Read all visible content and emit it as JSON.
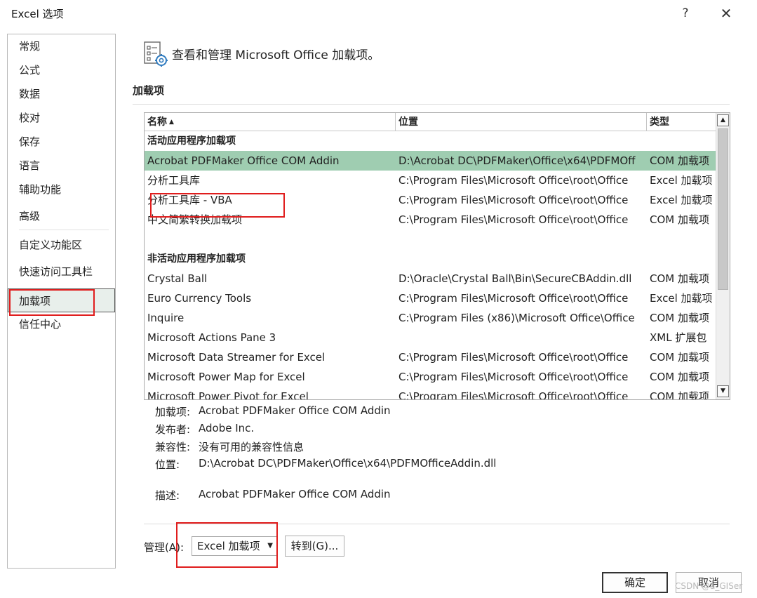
{
  "window": {
    "title": "Excel 选项",
    "help_label": "?",
    "close_label": "✕"
  },
  "sidebar": {
    "items": [
      {
        "label": "常规"
      },
      {
        "label": "公式"
      },
      {
        "label": "数据"
      },
      {
        "label": "校对"
      },
      {
        "label": "保存"
      },
      {
        "label": "语言"
      },
      {
        "label": "辅助功能"
      },
      {
        "label": "高级"
      },
      {
        "label": "自定义功能区"
      },
      {
        "label": "快速访问工具栏"
      },
      {
        "label": "加载项",
        "selected": true
      },
      {
        "label": "信任中心"
      }
    ]
  },
  "main": {
    "heading": "查看和管理 Microsoft Office 加载项。",
    "section_title": "加载项",
    "table": {
      "columns": [
        "名称",
        "位置",
        "类型"
      ],
      "sort_indicator": "▲",
      "active_group": "活动应用程序加载项",
      "active_rows": [
        {
          "name": "Acrobat PDFMaker Office COM Addin",
          "location": "D:\\Acrobat DC\\PDFMaker\\Office\\x64\\PDFMOff",
          "type": "COM 加载项",
          "selected": true
        },
        {
          "name": "分析工具库",
          "location": "C:\\Program Files\\Microsoft Office\\root\\Office",
          "type": "Excel 加载项"
        },
        {
          "name": "分析工具库 - VBA",
          "location": "C:\\Program Files\\Microsoft Office\\root\\Office",
          "type": "Excel 加载项"
        },
        {
          "name": "中文简繁转换加载项",
          "location": "C:\\Program Files\\Microsoft Office\\root\\Office",
          "type": "COM 加载项"
        }
      ],
      "inactive_group": "非活动应用程序加载项",
      "inactive_rows": [
        {
          "name": "Crystal Ball",
          "location": "D:\\Oracle\\Crystal Ball\\Bin\\SecureCBAddin.dll",
          "type": "COM 加载项"
        },
        {
          "name": "Euro Currency Tools",
          "location": "C:\\Program Files\\Microsoft Office\\root\\Office",
          "type": "Excel 加载项"
        },
        {
          "name": "Inquire",
          "location": "C:\\Program Files (x86)\\Microsoft Office\\Office",
          "type": "COM 加载项"
        },
        {
          "name": "Microsoft Actions Pane 3",
          "location": "",
          "type": "XML 扩展包"
        },
        {
          "name": "Microsoft Data Streamer for Excel",
          "location": "C:\\Program Files\\Microsoft Office\\root\\Office",
          "type": "COM 加载项"
        },
        {
          "name": "Microsoft Power Map for Excel",
          "location": "C:\\Program Files\\Microsoft Office\\root\\Office",
          "type": "COM 加载项"
        },
        {
          "name": "Microsoft Power Pivot for Excel",
          "location": "C:\\Program Files\\Microsoft Office\\root\\Office",
          "type": "COM 加载项"
        }
      ]
    },
    "details": {
      "addin_label": "加载项:",
      "addin_value": "Acrobat PDFMaker Office COM Addin",
      "publisher_label": "发布者:",
      "publisher_value": "Adobe Inc.",
      "compat_label": "兼容性:",
      "compat_value": "没有可用的兼容性信息",
      "location_label": "位置:",
      "location_value": "D:\\Acrobat DC\\PDFMaker\\Office\\x64\\PDFMOfficeAddin.dll",
      "desc_label": "描述:",
      "desc_value": "Acrobat PDFMaker Office COM Addin"
    },
    "manage": {
      "label": "管理(A):",
      "selected": "Excel 加载项",
      "goto_label": "转到(G)..."
    }
  },
  "footer": {
    "ok_label": "确定",
    "cancel_label": "取消"
  },
  "watermark": "CSDN @a_GISer",
  "colors": {
    "selected_row": "#9fcdb1",
    "highlight_box": "#e01d1d"
  }
}
